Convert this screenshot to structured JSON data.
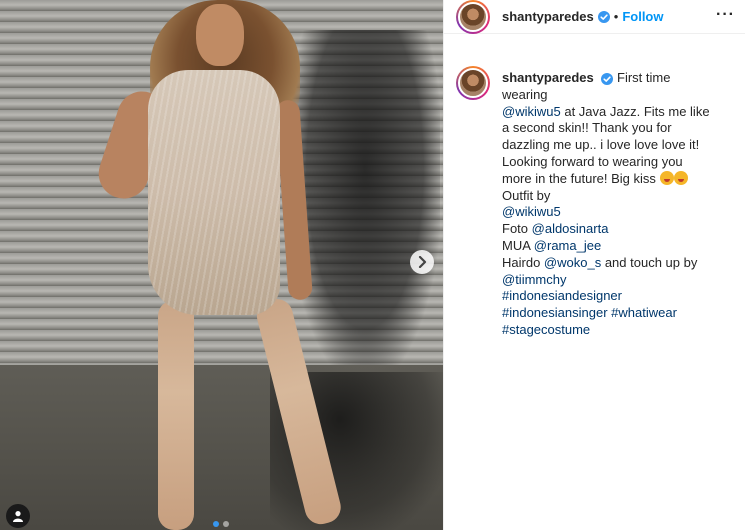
{
  "post": {
    "username": "shantyparedes",
    "separator": "•",
    "follow_label": "Follow",
    "more_label": "···"
  },
  "caption": {
    "username": "shantyparedes",
    "segments": {
      "t1": "First time wearing",
      "m1": "@wikiwu5",
      "t2": "at Java Jazz. Fits me like a second skin!! Thank you for dazzling me up.. i love love love it! Looking forward to wearing you more in the future! Big kiss",
      "t3": "Outfit by",
      "m2": "@wikiwu5",
      "t4": "Foto",
      "m3": "@aldosinarta",
      "t5": "MUA",
      "m4": "@rama_jee",
      "t6": "Hairdo",
      "m5": "@woko_s",
      "t7": "and touch up by",
      "m6": "@tiimmchy",
      "h1": "#indonesiandesigner",
      "h2": "#indonesiansinger",
      "h3": "#whatiwear",
      "h4": "#stagecostume"
    },
    "emojis": [
      "kissing-face",
      "kissing-face"
    ]
  },
  "carousel": {
    "slide_count": 2,
    "active_index": 0
  },
  "icons": {
    "verified": "verified-badge-icon",
    "next": "chevron-right-icon",
    "user_tag": "user-tag-icon"
  },
  "colors": {
    "link": "#00376b",
    "follow": "#0095f6",
    "verified": "#3897f0",
    "active_dot": "#3897f0"
  }
}
